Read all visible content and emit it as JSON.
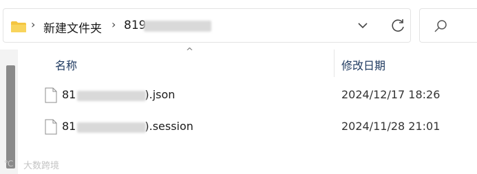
{
  "address_bar": {
    "crumbs": [
      "新建文件夹",
      "819"
    ],
    "separator": "›"
  },
  "columns": {
    "name": "名称",
    "date_modified": "修改日期"
  },
  "files": [
    {
      "name_prefix": "81",
      "name_suffix": ").json",
      "modified": "2024/12/17 18:26"
    },
    {
      "name_prefix": "81",
      "name_suffix": ").session",
      "modified": "2024/11/28 21:01"
    }
  ],
  "watermark": {
    "text": "大数跨境",
    "logo_text": "℃"
  },
  "colors": {
    "folder": "#f4c541",
    "header_text": "#1f3a60",
    "scrollbar": "#8a8a8a"
  }
}
